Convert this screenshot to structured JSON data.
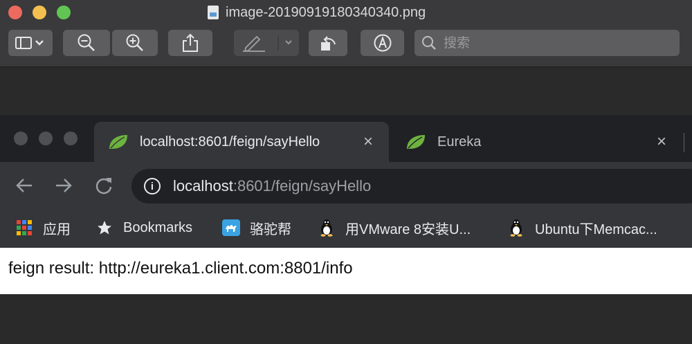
{
  "preview": {
    "title": "image-20190919180340340.png",
    "search_placeholder": "搜索",
    "toolbar_icons": [
      "sidebar-icon",
      "zoom-out-icon",
      "zoom-in-icon",
      "share-icon",
      "markup-pen-icon",
      "rotate-icon",
      "annotate-icon"
    ]
  },
  "browser": {
    "tabs": [
      {
        "title": "localhost:8601/feign/sayHello",
        "icon": "spring-leaf-icon",
        "active": true
      },
      {
        "title": "Eureka",
        "icon": "spring-leaf-icon",
        "active": false
      }
    ],
    "close_glyph": "×",
    "address": {
      "host": "localhost",
      "rest": ":8601/feign/sayHello"
    },
    "bookmarks": [
      {
        "label": "应用",
        "icon": "apps-grid-icon"
      },
      {
        "label": "Bookmarks",
        "icon": "star-icon"
      },
      {
        "label": "骆驼帮",
        "icon": "camel-icon"
      },
      {
        "label": "用VMware 8安装U...",
        "icon": "tux-icon"
      },
      {
        "label": "Ubuntu下Memcac...",
        "icon": "tux-icon"
      }
    ]
  },
  "page": {
    "text": "feign result: http://eureka1.client.com:8801/info"
  },
  "colors": {
    "spring_green": "#6db33f",
    "tab_active": "#35363a",
    "tabstrip": "#202124"
  }
}
